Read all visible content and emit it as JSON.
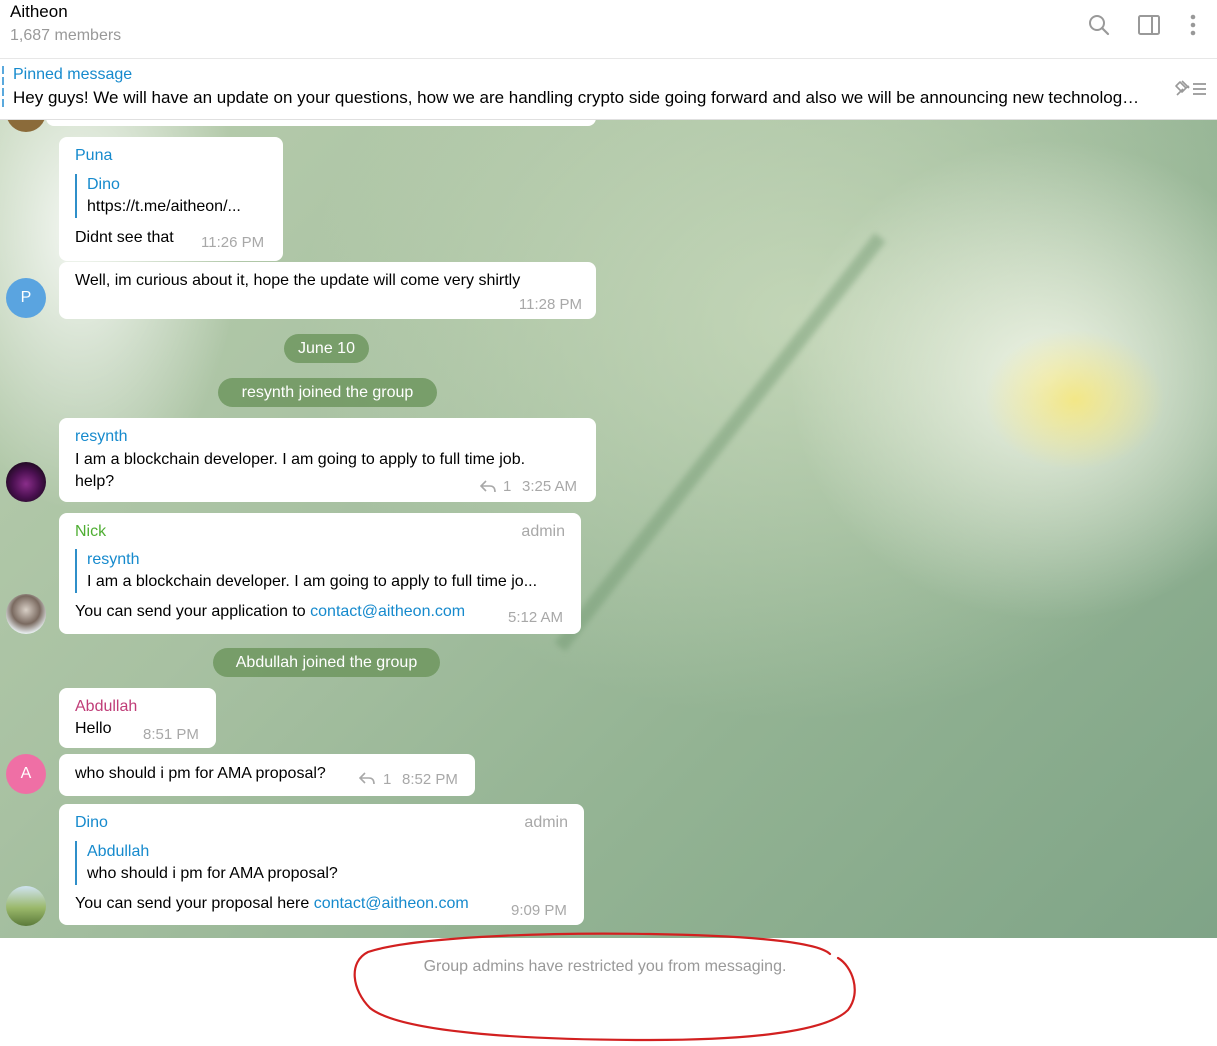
{
  "header": {
    "title": "Aitheon",
    "members": "1,687 members",
    "icons": [
      "search-icon",
      "sidebar-toggle-icon",
      "more-vert-icon"
    ]
  },
  "pinned": {
    "label": "Pinned message",
    "text": "Hey guys! We will have an update on your questions, how we are handling crypto side going forward and also we will be announcing new technology ...",
    "icon": "unpin-list-icon"
  },
  "messages": {
    "puna": {
      "sender": "Puna",
      "reply_name": "Dino",
      "reply_text": "https://t.me/aitheon/...",
      "text": "Didnt see that",
      "time": "11:26 PM"
    },
    "puna2": {
      "text": "Well, im curious about it, hope the update will come very shirtly",
      "time": "11:28 PM",
      "avatar_letter": "P"
    },
    "date_sep": "June 10",
    "join1": "resynth joined the group",
    "resynth": {
      "sender": "resynth",
      "text_line1": "I am a blockchain developer. I am going to apply to full time job.",
      "text_line2": "help?",
      "reply_count": "1",
      "time": "3:25 AM"
    },
    "nick": {
      "sender": "Nick",
      "badge": "admin",
      "reply_name": "resynth",
      "reply_text": "I am a blockchain developer. I am going to apply to full time jo...",
      "text": "You can send your application to ",
      "link": "contact@aitheon.com",
      "time": "5:12 AM"
    },
    "join2": "Abdullah joined the group",
    "abdullah": {
      "sender": "Abdullah",
      "text": "Hello",
      "time": "8:51 PM"
    },
    "abdullah2": {
      "text": "who should i pm for AMA proposal?",
      "reply_count": "1",
      "time": "8:52 PM",
      "avatar_letter": "A"
    },
    "dino": {
      "sender": "Dino",
      "badge": "admin",
      "reply_name": "Abdullah",
      "reply_text": "who should i pm for AMA proposal?",
      "text": "You can send your proposal here ",
      "link": "contact@aitheon.com",
      "time": "9:09 PM"
    }
  },
  "footer": {
    "restriction": "Group admins have restricted you from messaging."
  },
  "colors": {
    "link": "#168acd",
    "nick_name": "#4fae33",
    "abdullah_name": "#c03d78",
    "annotation": "#d22020",
    "avatar_p": "#5aa4e0",
    "avatar_a": "#ef6fa5"
  }
}
